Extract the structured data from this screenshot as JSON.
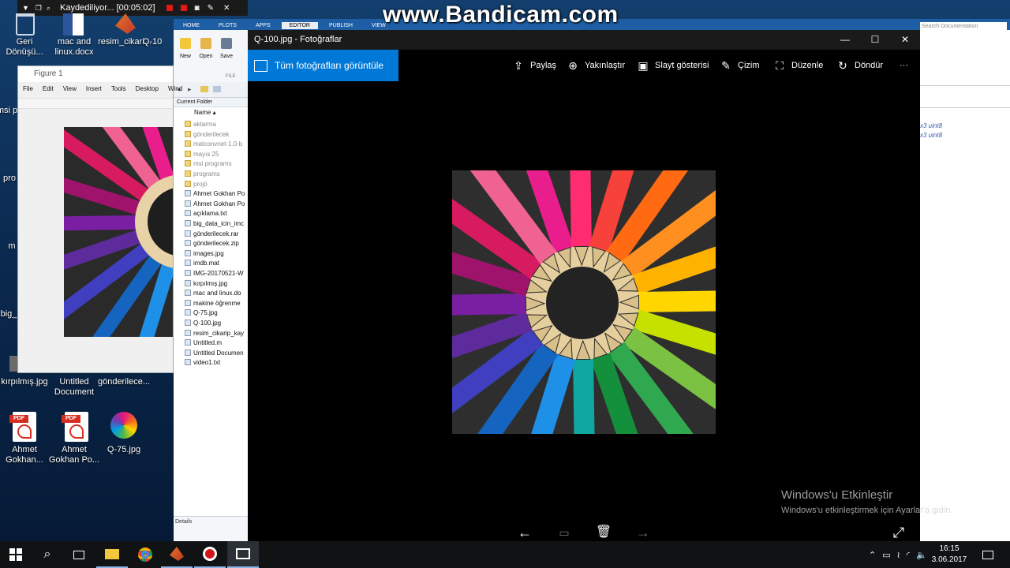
{
  "recorder": {
    "status": "Kaydediliyor... [00:05:02]"
  },
  "watermark": "www.Bandicam.com",
  "desktop_icons": [
    {
      "label": "Geri\nDönüşü..."
    },
    {
      "label": "mac and\nlinux.docx"
    },
    {
      "label": "resim_cikari..."
    },
    {
      "label": "Q-10"
    },
    {
      "label": "msi p"
    },
    {
      "label": "pro"
    },
    {
      "label": "m"
    },
    {
      "label": "big_"
    },
    {
      "label": "kırpılmış.jpg"
    },
    {
      "label": "Untitled\nDocument"
    },
    {
      "label": "gönderilece..."
    },
    {
      "label": "Ahmet\nGokhan..."
    },
    {
      "label": "Ahmet\nGokhan Po..."
    },
    {
      "label": "Q-75.jpg"
    }
  ],
  "matlab": {
    "tabs": [
      "HOME",
      "PLOTS",
      "APPS",
      "EDITOR",
      "PUBLISH",
      "VIEW"
    ],
    "ribbon": {
      "new": "New",
      "open": "Open",
      "save": "Save",
      "section": "FILE"
    },
    "current_folder_label": "Current Folder",
    "name_header": "Name",
    "files": [
      "aktarma",
      "gönderilecek",
      "matconvnet-1.0-b",
      "mayıs 25",
      "msi programs",
      "programs",
      "projö",
      "Ahmet Gokhan Po",
      "Ahmet Gokhan Po",
      "açıklama.txt",
      "big_data_icin_imc",
      "gönderilecek.rar",
      "gönderilecek.zip",
      "images.jpg",
      "imdb.mat",
      "IMG-20170521-W",
      "kırpılmış.jpg",
      "mac and linux.do",
      "makine öğrenme",
      "Q-75.jpg",
      "Q-100.jpg",
      "resim_cikarip_kay",
      "Untitled.m",
      "Untitled Documen",
      "video1.txt"
    ],
    "details_label": "Details",
    "search_placeholder": "Search Documentation",
    "workspace_rows": [
      "x3 uint8",
      "x3 uint8"
    ]
  },
  "figure": {
    "title": "Figure 1",
    "menu": [
      "File",
      "Edit",
      "View",
      "Insert",
      "Tools",
      "Desktop",
      "Wind"
    ]
  },
  "photos": {
    "window_title": "Q-100.jpg - Fotoğraflar",
    "all_photos_button": "Tüm fotoğrafları görüntüle",
    "toolbar": {
      "share": "Paylaş",
      "zoom": "Yakınlaştır",
      "slideshow": "Slayt gösterisi",
      "draw": "Çizim",
      "edit": "Düzenle",
      "rotate": "Döndür",
      "more": "···"
    }
  },
  "activation": {
    "line1": "Windows'u Etkinleştir",
    "line2": "Windows'u etkinleştirmek için Ayarlar'a gidin."
  },
  "taskbar": {
    "time": "16:15",
    "date": "3.06.2017"
  },
  "icons": {
    "minimize": "minimize-icon",
    "maximize": "maximize-icon",
    "close": "close-icon",
    "back": "arrow-left-icon",
    "forward": "arrow-right-icon",
    "delete": "trash-icon",
    "fullscreen": "expand-icon",
    "start": "windows-logo-icon"
  },
  "colors": {
    "accent": "#0078d7",
    "matlab_blue": "#1d5ea4",
    "desktop": "#0b2a50"
  }
}
